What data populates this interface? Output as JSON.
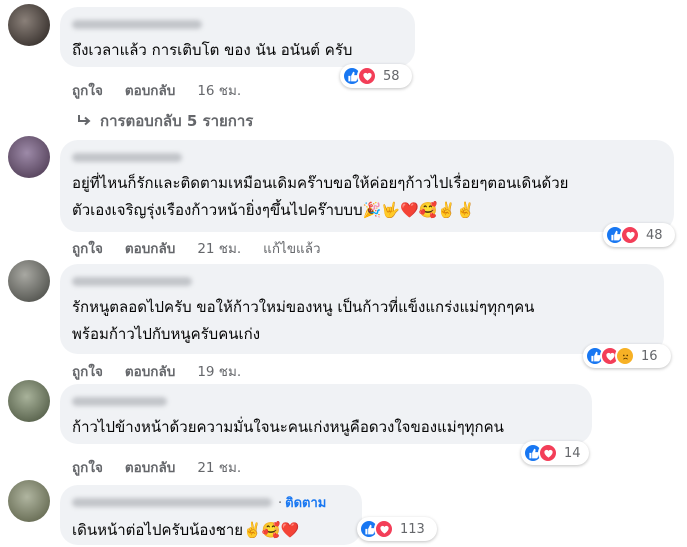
{
  "comments": [
    {
      "text_lines": [
        "ถึงเวลาแล้ว การเติบโต ของ นัน อนันต์ ครับ"
      ],
      "actions": {
        "like": "ถูกใจ",
        "reply": "ตอบกลับ",
        "time": "16 ชม.",
        "edited": ""
      },
      "reaction_icons": [
        "like-icon",
        "love-icon"
      ],
      "reaction_count": "58"
    },
    {
      "text_lines": [
        "อยู่ที่ไหนก็รักและติดตามเหมือนเดิมคร๊าบขอให้ค่อยๆก้าวไปเรื่อยๆตอนเดินด้วย",
        "ตัวเองเจริญรุ่งเรืองก้าวหน้ายิ่งๆขึ้นไปคร๊าบบบ🎉🤟❤️🥰✌️✌️"
      ],
      "actions": {
        "like": "ถูกใจ",
        "reply": "ตอบกลับ",
        "time": "21 ชม.",
        "edited": "แก้ไขแล้ว"
      },
      "reaction_icons": [
        "like-icon",
        "love-icon"
      ],
      "reaction_count": "48"
    },
    {
      "text_lines": [
        "รักหนูตลอดไปครับ ขอให้ก้าวใหม่ของหนู เป็นก้าวที่แข็งแกร่งแม่ๆทุกๆคน",
        "พร้อมก้าวไปกับหนูครับคนเก่ง"
      ],
      "actions": {
        "like": "ถูกใจ",
        "reply": "ตอบกลับ",
        "time": "19 ชม.",
        "edited": ""
      },
      "reaction_icons": [
        "like-icon",
        "love-icon",
        "sad-icon"
      ],
      "reaction_count": "16"
    },
    {
      "text_lines": [
        "ก้าวไปข้างหน้าด้วยความมั่นใจนะคนเก่งหนูคือดวงใจของแม่ๆทุกคน"
      ],
      "actions": {
        "like": "ถูกใจ",
        "reply": "ตอบกลับ",
        "time": "21 ชม.",
        "edited": ""
      },
      "reaction_icons": [
        "like-icon",
        "love-icon"
      ],
      "reaction_count": "14"
    },
    {
      "text_lines": [
        "เดินหน้าต่อไปครับน้องชาย✌️🥰❤️"
      ],
      "follow": {
        "dot": "·",
        "label": "ติดตาม"
      },
      "actions": {
        "like": "",
        "reply": "",
        "time": "",
        "edited": ""
      },
      "reaction_icons": [
        "like-icon",
        "love-icon"
      ],
      "reaction_count": "113"
    }
  ],
  "view_replies": {
    "icon": "reply-arrow-icon",
    "label": "การตอบกลับ 5 รายการ"
  },
  "colors": {
    "like": "#1877f2",
    "love": "#f33e58",
    "sad": "#f7b125",
    "bubble": "#f0f2f5",
    "meta": "#65676b"
  }
}
